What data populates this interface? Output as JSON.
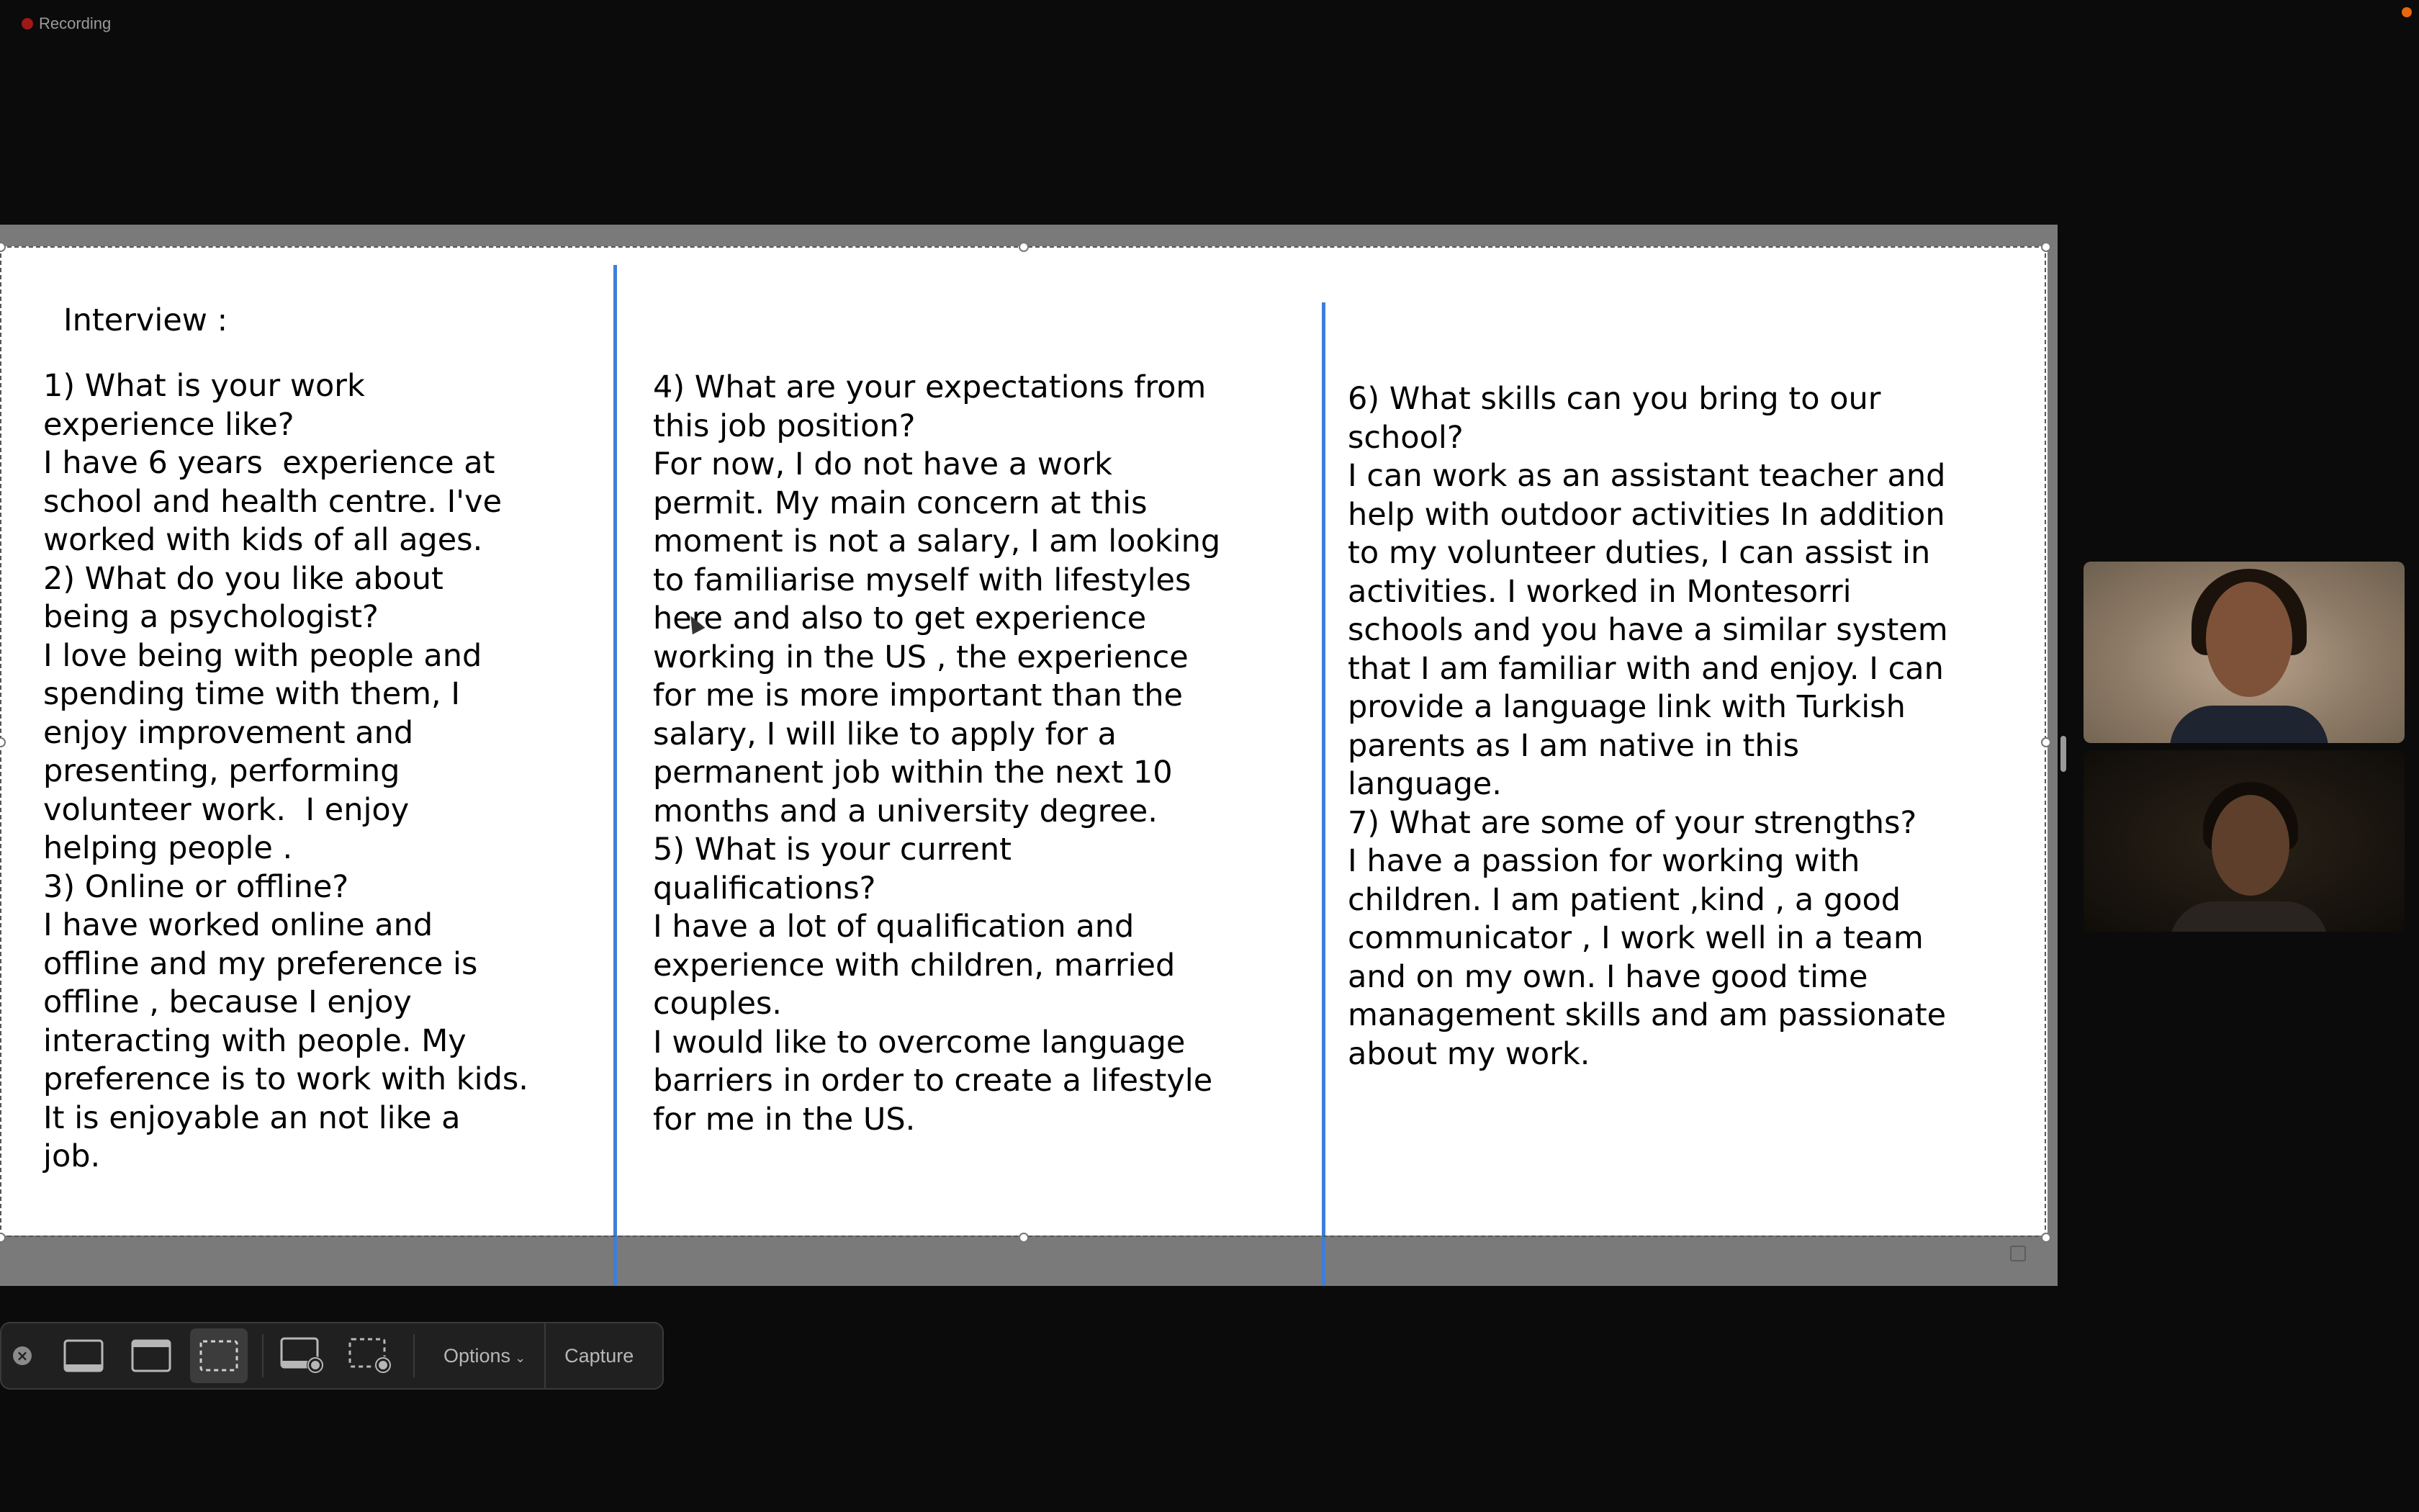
{
  "recording": {
    "label": "Recording"
  },
  "document": {
    "title": "Interview :",
    "columns": [
      "1) What is your work\nexperience like?\nI have 6 years  experience at\nschool and health centre. I've\nworked with kids of all ages.\n2) What do you like about\nbeing a psychologist?\nI love being with people and\nspending time with them, I\nenjoy improvement and\npresenting, performing\nvolunteer work.  I enjoy\nhelping people .\n3) Online or offline?\nI have worked online and\noffline and my preference is\noffline , because I enjoy\ninteracting with people. My\npreference is to work with kids.\nIt is enjoyable an not like a\njob.",
      "4) What are your expectations from\nthis job position?\nFor now, I do not have a work\npermit. My main concern at this\nmoment is not a salary, I am looking\nto familiarise myself with lifestyles\nhere and also to get experience\nworking in the US , the experience\nfor me is more important than the\nsalary, I will like to apply for a\npermanent job within the next 10\nmonths and a university degree.\n5) What is your current\nqualifications?\nI have a lot of qualification and\nexperience with children, married\ncouples.\nI would like to overcome language\nbarriers in order to create a lifestyle\nfor me in the US.",
      "6) What skills can you bring to our\nschool?\nI can work as an assistant teacher and\nhelp with outdoor activities In addition\nto my volunteer duties, I can assist in\nactivities. I worked in Montesorri\nschools and you have a similar system\nthat I am familiar with and enjoy. I can\nprovide a language link with Turkish\nparents as I am native in this\nlanguage.\n7) What are some of your strengths?\nI have a passion for working with\nchildren. I am patient ,kind , a good\ncommunicator , I work well in a team\nand on my own. I have good time\nmanagement skills and am passionate\nabout my work."
    ]
  },
  "toolbar": {
    "options_label": "Options",
    "capture_label": "Capture",
    "icons": [
      "close-icon",
      "capture-entire-screen-icon",
      "capture-window-icon",
      "capture-selection-icon",
      "record-entire-screen-icon",
      "record-selection-icon"
    ]
  },
  "colors": {
    "column_rule": "#3f7ed8",
    "recording_dot": "#a01818"
  }
}
